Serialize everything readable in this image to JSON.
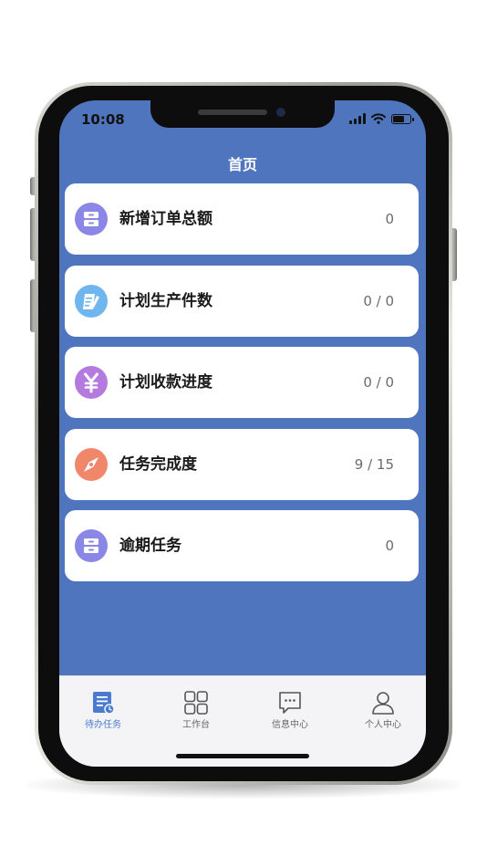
{
  "status_bar": {
    "time": "10:08"
  },
  "header": {
    "title": "首页"
  },
  "cards": [
    {
      "label": "新增订单总额",
      "value": "0",
      "icon": "drawer-icon",
      "color": "#8b87e6"
    },
    {
      "label": "计划生产件数",
      "value": "0 / 0",
      "icon": "note-pencil-icon",
      "color": "#6fb6ee"
    },
    {
      "label": "计划收款进度",
      "value": "0 / 0",
      "icon": "yen-icon",
      "color": "#b57ae0"
    },
    {
      "label": "任务完成度",
      "value": "9 / 15",
      "icon": "compass-icon",
      "color": "#f0866a"
    },
    {
      "label": "逾期任务",
      "value": "0",
      "icon": "drawer-icon",
      "color": "#8b87e6"
    }
  ],
  "tabbar": {
    "tabs": [
      {
        "label": "待办任务",
        "icon": "todo-document-icon",
        "active": true
      },
      {
        "label": "工作台",
        "icon": "grid-icon",
        "active": false
      },
      {
        "label": "信息中心",
        "icon": "message-icon",
        "active": false
      },
      {
        "label": "个人中心",
        "icon": "person-icon",
        "active": false
      }
    ]
  },
  "colors": {
    "header_background": "#4e75bd",
    "active_tab": "#4a7bd0"
  }
}
